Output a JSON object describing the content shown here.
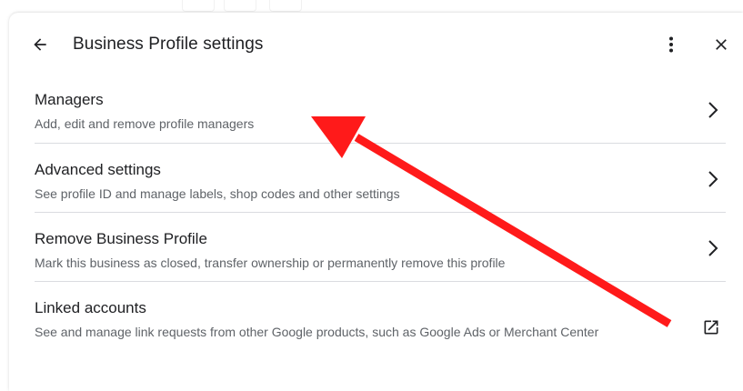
{
  "header": {
    "title": "Business Profile settings",
    "back_icon": "arrow-back-icon",
    "more_icon": "more-vert-icon",
    "close_icon": "close-icon"
  },
  "items": [
    {
      "label": "Managers",
      "description": "Add, edit and remove profile managers",
      "trailing_icon": "chevron-right-icon"
    },
    {
      "label": "Advanced settings",
      "description": "See profile ID and manage labels, shop codes and other settings",
      "trailing_icon": "chevron-right-icon"
    },
    {
      "label": "Remove Business Profile",
      "description": "Mark this business as closed, transfer ownership or permanently remove this profile",
      "trailing_icon": "chevron-right-icon"
    },
    {
      "label": "Linked accounts",
      "description": "See and manage link requests from other Google products, such as Google Ads or Merchant Center",
      "trailing_icon": "open-in-new-icon"
    }
  ],
  "colors": {
    "primary_text": "#202124",
    "secondary_text": "#5f6368",
    "divider": "#dadce0",
    "icon": "#5f6368",
    "annotation_arrow": "#ff1a1a"
  },
  "annotation": {
    "type": "red-arrow",
    "points_to": "Managers"
  }
}
